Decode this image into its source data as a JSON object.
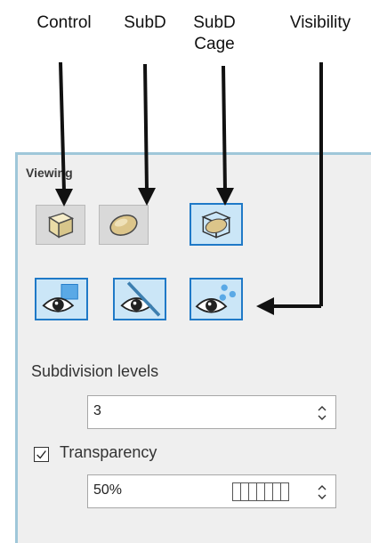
{
  "annotations": {
    "control": "Control",
    "subd": "SubD",
    "subd_cage_line1": "SubD",
    "subd_cage_line2": "Cage",
    "visibility": "Visibility"
  },
  "panel": {
    "title": "Viewing",
    "display_buttons": [
      {
        "name": "control",
        "icon": "box-icon",
        "active": false
      },
      {
        "name": "subd",
        "icon": "ellipsoid-icon",
        "active": false
      },
      {
        "name": "subd-cage",
        "icon": "caged-box-icon",
        "active": true
      }
    ],
    "visibility_buttons": [
      {
        "icon": "eye-square-icon",
        "active": true
      },
      {
        "icon": "eye-slash-icon",
        "active": true
      },
      {
        "icon": "eye-points-icon",
        "active": true
      }
    ],
    "subdivision_label": "Subdivision levels",
    "subdivision_value": "3",
    "transparency_label": "Transparency",
    "transparency_checked": true,
    "transparency_value": "50%",
    "transparency_level": 0.5
  },
  "colors": {
    "panel_border": "#9fc7d9",
    "active_border": "#1f79c7",
    "active_fill": "#cbe6f7"
  }
}
